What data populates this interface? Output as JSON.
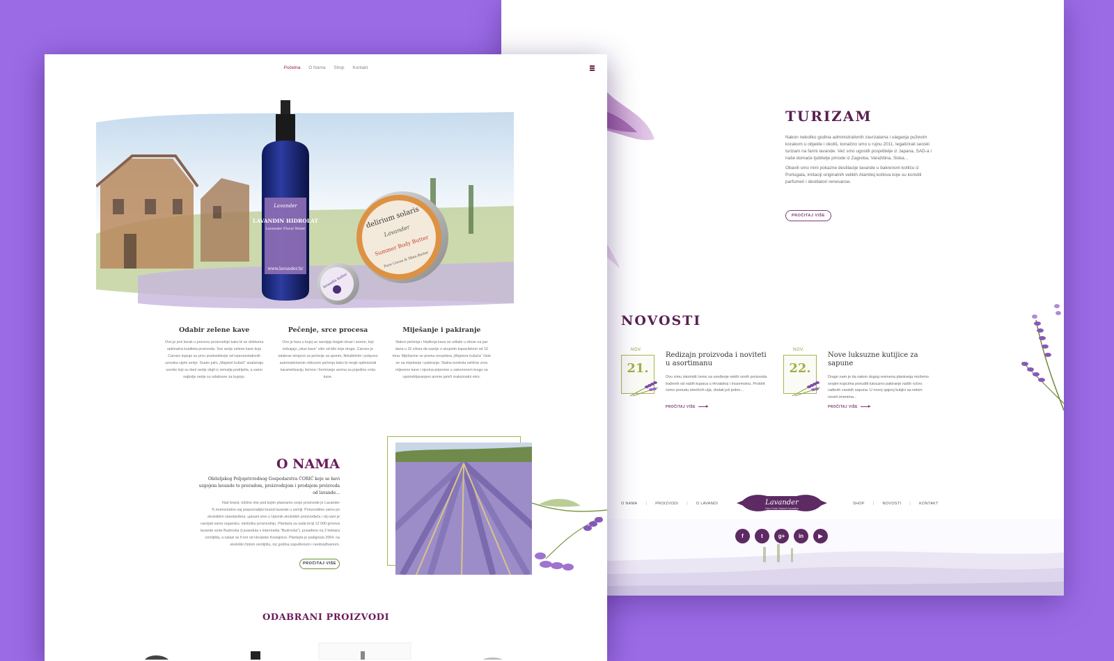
{
  "colors": {
    "background": "#9b6be6",
    "brand": "#6a1c5a",
    "accent_green": "#a3ae45"
  },
  "right_sheet": {
    "turizam": {
      "title": "TURIZAM",
      "paragraph_1": "Nakon nekoliko godina administrativnih zavrzalama i ulaganja puževim korakom u objekte i okoliš, konačno smo u rujnu 2011. legalizirali seoski turizam na farmi lavande. Već smo ugostili posjetitelje iz Japana, SAD-a i naše domaće ljubitelje prirode iz Zagreba, Varaždina, Siska...",
      "paragraph_2": "Obavili smo mini pokazne destilacije lavande u bakrenom kotliću iz Portugala, imitaciji originalnih velikih Alambiq kotlova koje su koristili parfumeri i destilatori renesanse.",
      "button": "PROČITAJ VIŠE"
    },
    "novosti": {
      "title": "NOVOSTI",
      "items": [
        {
          "month": "NOV.",
          "day": "21.",
          "title": "Redizajn proizvoda i noviteti u asortimanu",
          "text": "Ovu zimu iskoristit ćemo za uvođenje nekih novih proizvoda traženih od naših kupaca u Hrvatskoj i inozemstvu. Proširit ćemo ponudu eteričnih ulja, dodati još jedno...",
          "more": "PROČITAJ VIŠE"
        },
        {
          "month": "NOV.",
          "day": "22.",
          "title": "Nove luksuzne kutijice za sapune",
          "text": "Drago nam je da nakon dugog vremena planiranja možemo svojim kupcima ponuditi luksuzno pakiranje naših ručno rađenih carskih sapuna. U novoj sjajnoj kutijici sa nekim novim imenima...",
          "more": "PROČITAJ VIŠE"
        }
      ]
    },
    "footer": {
      "nav_left": [
        "O NAMA",
        "PROIZVODI",
        "O LAVANDI"
      ],
      "nav_right": [
        "SHOP",
        "NOVOSTI",
        "KONTAKT"
      ],
      "logo_text": "Lavander",
      "logo_sub": "Farm Fresh Natural Cosmetics",
      "socials": [
        {
          "icon": "facebook-icon",
          "glyph": "f"
        },
        {
          "icon": "twitter-icon",
          "glyph": "t"
        },
        {
          "icon": "googleplus-icon",
          "glyph": "g+"
        },
        {
          "icon": "linkedin-icon",
          "glyph": "in"
        },
        {
          "icon": "youtube-icon",
          "glyph": "▶"
        }
      ]
    }
  },
  "left_sheet": {
    "nav": {
      "items": [
        "Početna",
        "O Nama",
        "Shop",
        "Kontakt"
      ],
      "active": "Početna"
    },
    "hero": {
      "bottle_brand": "Lavander",
      "bottle_label": "LAVANDIN HIDROLAT",
      "bottle_sub": "Lavender Floral Water",
      "bottle_url": "www.lavander.hr",
      "tin_brand": "delirium solaris",
      "tin_script": "Lavander",
      "tin_product": "Summer Body Butter",
      "tin_footer": "Pure Cocoa & Shea Butter",
      "small_tin": "lavandin butter"
    },
    "features": [
      {
        "title": "Odabir zelene kave",
        "text": "Ovo je prvi korak u procesu proizvodnje kako bi se dobivena optimalna kvaliteta proizvoda. Sve serije zelene kave koje Carraro kupuje su prvo predselekcije od reprezentativnih uzoraka cijele serije. Svako jutro „Majstori kušači“ analiziraju uzorke koji su dani ranije stigli iz zemalja podrijetla, a samo najbolje serije su odabrane za kupnju."
      },
      {
        "title": "Pečenje, srce procesa",
        "text": "Ovo je faza u kojoj se razvijaju bogati okusi i arome, koji izdvajaju „okus kave“ više od bilo koje druge. Carraro je odabrao strojeve za pečenje sa sporim, fleksibilnim i potpuno automatiziranim ciklusom pečenja kako bi mogli optimizirati karamelizaciju šećera i formiranje aroma za pojedinu vrstu kave."
      },
      {
        "title": "Miješanje i pakiranje",
        "text": "Nakon pečenja i hlađenja kava se odlaže u silose na par dana u 32 silosa da sazrije s ukupnim kapacitetom od 10 tona. Mješavine se prema receptima „Majstora kušača“ čiste se na miješanje i pakiranje. Stalna kontrola veličine zrna mljevene kave i njezina pripreme u zatvorenom krugu sa upotrebljavanjem arome jamči maksimalni mirs."
      }
    ],
    "o_nama": {
      "title": "O NAMA",
      "lead": "Obiteljskog Poljoprivrednog Gospodarstva ĆORIĆ koje se bavi uzgojem lavande te preradom, proizvodnjom i prodajom proizvoda od lavande...",
      "body": "Naš brand, tržišno ime pod kojim plasiramo svoje proizvode je Lavander ®,momentalno naj prepoznatljivi brand lavande u zemlji. Proizvodimo samo po ekološkim standardima, upisani smo u Upisnik ekoloških proizvođača i cilj nam je razvijati samo organsku, ekološku proizvodnju. Plantaža za sada broji 12 000 grmova lavande sorte Budrovka (Lavandula x intermedia \"Budrovka\"), posađene na 2 hektara zemljišta, a nalazi se 6 km od Hrvatske Kostajnice. Plantaža je podignuta 2004. na ekološki čistom zemljištu, niz godina zapuštenom i neobrađivanom.",
      "button": "PROČITAJ VIŠE"
    },
    "products": {
      "title": "ODABRANI PROIZVODI"
    }
  }
}
